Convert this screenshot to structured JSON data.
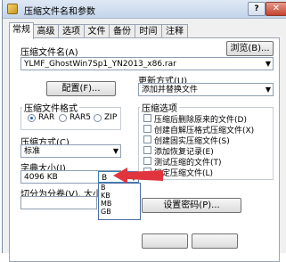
{
  "window": {
    "title": "压缩文件名和参数",
    "help_label": "?",
    "close_label": "✕"
  },
  "tabs": [
    "常规",
    "高级",
    "选项",
    "文件",
    "备份",
    "时间",
    "注释"
  ],
  "general": {
    "archive_name_label": "压缩文件名(A)",
    "browse_button": "浏览(B)...",
    "archive_name_value": "YLMF_GhostWin7Sp1_YN2013_x86.rar",
    "update_mode_label": "更新方式(U)",
    "update_mode_value": "添加并替换文件",
    "profiles_button": "配置(F)...",
    "format_group_label": "压缩文件格式",
    "formats": [
      "RAR",
      "RAR5",
      "ZIP"
    ],
    "selected_format": "RAR",
    "method_label": "压缩方式(C)",
    "method_value": "标准",
    "dict_label": "字典大小(I)",
    "dict_value": "4096 KB",
    "split_label": "切分为分卷(V), 大小",
    "split_unit_value": "B",
    "split_unit_options": [
      "B",
      "KB",
      "MB",
      "GB"
    ],
    "options_group_label": "压缩选项",
    "options": [
      "压缩后删除原来的文件(D)",
      "创建自解压格式压缩文件(X)",
      "创建固实压缩文件(S)",
      "添加恢复记录(E)",
      "测试压缩的文件(T)",
      "锁定压缩文件(L)"
    ],
    "set_password_button": "设置密码(P)..."
  },
  "colors": {
    "pointer_arrow": "#e0343f"
  }
}
